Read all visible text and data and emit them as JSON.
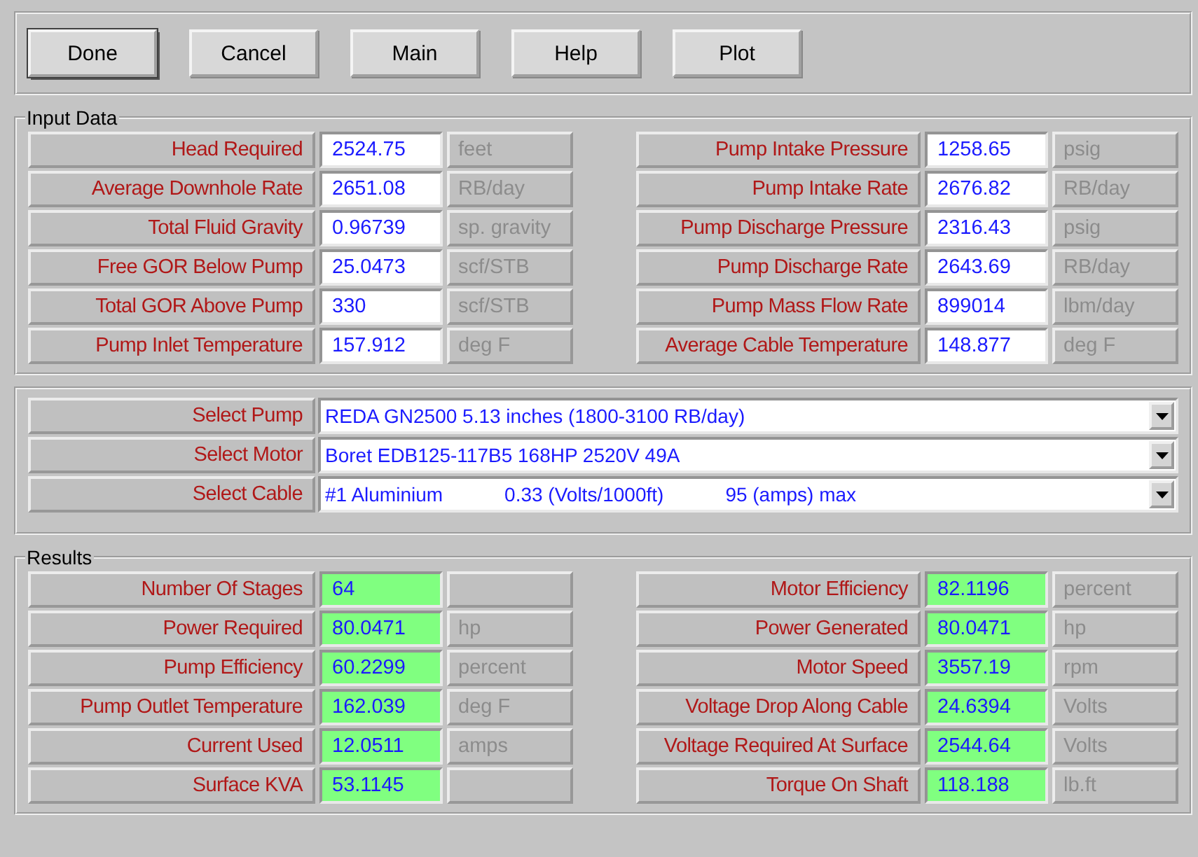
{
  "toolbar": {
    "buttons": [
      {
        "label": "Done",
        "default": true
      },
      {
        "label": "Cancel",
        "default": false
      },
      {
        "label": "Main",
        "default": false
      },
      {
        "label": "Help",
        "default": false
      },
      {
        "label": "Plot",
        "default": false
      }
    ]
  },
  "input_data": {
    "title": "Input Data",
    "kind": "input",
    "columns": [
      [
        {
          "label": "Head Required",
          "value": "2524.75",
          "unit": "feet"
        },
        {
          "label": "Average Downhole Rate",
          "value": "2651.08",
          "unit": "RB/day"
        },
        {
          "label": "Total Fluid Gravity",
          "value": "0.96739",
          "unit": "sp. gravity"
        },
        {
          "label": "Free GOR Below Pump",
          "value": "25.0473",
          "unit": "scf/STB"
        },
        {
          "label": "Total GOR Above Pump",
          "value": "330",
          "unit": "scf/STB"
        },
        {
          "label": "Pump Inlet Temperature",
          "value": "157.912",
          "unit": "deg F"
        }
      ],
      [
        {
          "label": "Pump Intake Pressure",
          "value": "1258.65",
          "unit": "psig"
        },
        {
          "label": "Pump Intake Rate",
          "value": "2676.82",
          "unit": "RB/day"
        },
        {
          "label": "Pump Discharge Pressure",
          "value": "2316.43",
          "unit": "psig"
        },
        {
          "label": "Pump Discharge Rate",
          "value": "2643.69",
          "unit": "RB/day"
        },
        {
          "label": "Pump Mass Flow Rate",
          "value": "899014",
          "unit": "lbm/day"
        },
        {
          "label": "Average Cable Temperature",
          "value": "148.877",
          "unit": "deg F"
        }
      ]
    ]
  },
  "selections": [
    {
      "label": "Select Pump",
      "parts": [
        "REDA GN2500 5.13 inches (1800-3100 RB/day)"
      ]
    },
    {
      "label": "Select Motor",
      "parts": [
        "Boret EDB125-117B5 168HP 2520V 49A"
      ]
    },
    {
      "label": "Select Cable",
      "parts": [
        "#1 Aluminium",
        "0.33 (Volts/1000ft)",
        "95 (amps) max"
      ]
    }
  ],
  "results": {
    "title": "Results",
    "kind": "result",
    "columns": [
      [
        {
          "label": "Number Of Stages",
          "value": "64"
        },
        {
          "label": "Power Required",
          "value": "80.0471",
          "unit": "hp"
        },
        {
          "label": "Pump Efficiency",
          "value": "60.2299",
          "unit": "percent"
        },
        {
          "label": "Pump Outlet Temperature",
          "value": "162.039",
          "unit": "deg F"
        },
        {
          "label": "Current Used",
          "value": "12.0511",
          "unit": "amps"
        },
        {
          "label": "Surface KVA",
          "value": "53.1145"
        }
      ],
      [
        {
          "label": "Motor Efficiency",
          "value": "82.1196",
          "unit": "percent"
        },
        {
          "label": "Power Generated",
          "value": "80.0471",
          "unit": "hp"
        },
        {
          "label": "Motor Speed",
          "value": "3557.19",
          "unit": "rpm"
        },
        {
          "label": "Voltage Drop Along Cable",
          "value": "24.6394",
          "unit": "Volts"
        },
        {
          "label": "Voltage Required At Surface",
          "value": "2544.64",
          "unit": "Volts"
        },
        {
          "label": "Torque On Shaft",
          "value": "118.188",
          "unit": "lb.ft"
        }
      ]
    ]
  }
}
